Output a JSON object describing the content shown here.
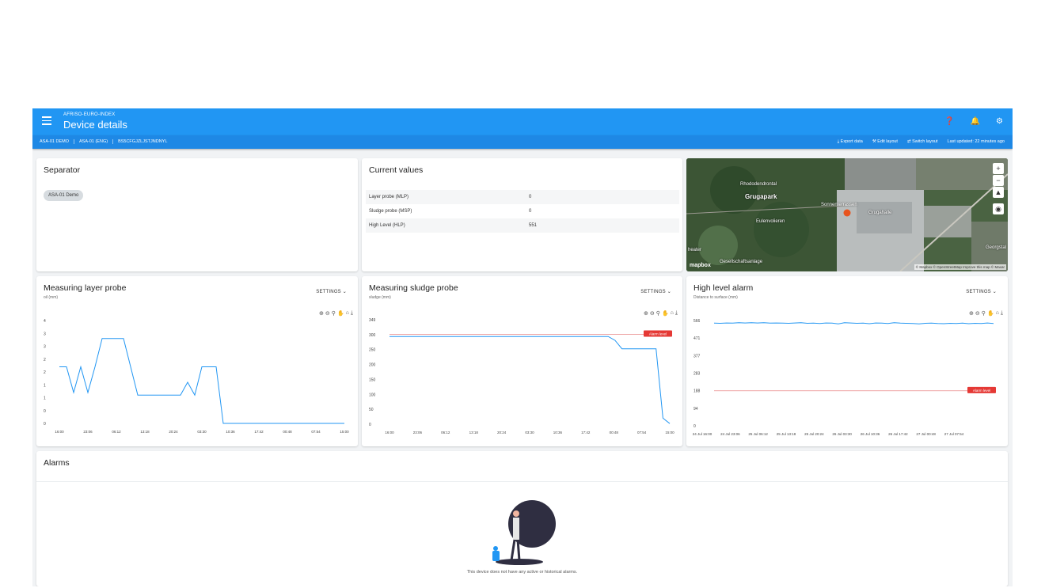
{
  "topbar": {
    "group": "AFRISO-EURO-INDEX",
    "title": "Device details",
    "icons": [
      "help-icon",
      "bell-icon",
      "user-settings-icon"
    ]
  },
  "subbar": {
    "crumbs": [
      "ASA-01 DEMO",
      "ASA-01 (ENG)",
      "BS5CFGJZLJSTJNDNYL"
    ],
    "export": "Export data",
    "edit_layout": "Edit layout",
    "switch_layout": "Switch layout",
    "last_updated": "Last updated: 22 minutes ago"
  },
  "separator": {
    "title": "Separator",
    "chip": "ASA-01 Demo"
  },
  "current_values": {
    "title": "Current values",
    "rows": [
      {
        "label": "Layer probe (MLP)",
        "value": "0"
      },
      {
        "label": "Sludge probe (MSP)",
        "value": "0"
      },
      {
        "label": "High Level (HLP)",
        "value": "551"
      }
    ]
  },
  "map": {
    "labels": [
      "Rhododendrontal",
      "Grugapark",
      "Eulenvolieren",
      "Sonnenterrassen",
      "Georgstal",
      "Grugahalle",
      "heater",
      "Gesellschaftsanlage"
    ],
    "attribution": "© Mapbox © OpenStreetMap Improve this map © Maxar",
    "logo": "mapbox",
    "marker_color": "#e8541e"
  },
  "settings_label": "SETTINGS",
  "chart_data": [
    {
      "type": "line",
      "title": "Measuring layer probe",
      "subtitle": "oil (mm)",
      "categories": [
        "16:00",
        "23:06",
        "06:12",
        "13:18",
        "20:24",
        "03:30",
        "10:36",
        "17:42",
        "00:48",
        "07:54",
        "15:00"
      ],
      "y_ticks": [
        "4",
        "3",
        "3",
        "2",
        "2",
        "1",
        "1",
        "0",
        "0"
      ],
      "ylim": [
        0,
        4
      ],
      "series": [
        {
          "values": [
            2.2,
            2.2,
            1.2,
            2.2,
            1.2,
            2.2,
            3.3,
            3.3,
            3.3,
            3.3,
            2.2,
            1.1,
            1.1,
            1.1,
            1.1,
            1.1,
            1.1,
            1.1,
            1.6,
            1.1,
            2.2,
            2.2,
            2.2,
            0,
            0,
            0,
            0,
            0,
            0,
            0,
            0,
            0,
            0,
            0,
            0,
            0,
            0,
            0,
            0,
            0,
            0
          ]
        }
      ],
      "color": "#2196f3"
    },
    {
      "type": "line",
      "title": "Measuring sludge probe",
      "subtitle": "sludge (mm)",
      "categories": [
        "16:00",
        "23:06",
        "06:12",
        "13:18",
        "20:24",
        "03:30",
        "10:36",
        "17:42",
        "00:48",
        "07:54",
        "15:00"
      ],
      "y_ticks": [
        "349",
        "300",
        "250",
        "200",
        "150",
        "100",
        "50",
        "0"
      ],
      "ylim": [
        0,
        349
      ],
      "alarm_level": 300,
      "alarm_label": "Alarm level",
      "series": [
        {
          "values": [
            293,
            293,
            293,
            293,
            293,
            293,
            293,
            293,
            293,
            293,
            293,
            293,
            293,
            293,
            293,
            293,
            293,
            293,
            293,
            293,
            293,
            293,
            293,
            293,
            293,
            293,
            293,
            293,
            293,
            293,
            293,
            293,
            293,
            280,
            252,
            252,
            252,
            252,
            252,
            252,
            20,
            2
          ]
        }
      ],
      "color": "#2196f3"
    },
    {
      "type": "line",
      "title": "High level alarm",
      "subtitle": "Distance to surface (mm)",
      "categories": [
        "24 Jul 16:00",
        "24 Jul 23:06",
        "25 Jul 06:12",
        "25 Jul 13:18",
        "25 Jul 20:24",
        "26 Jul 03:30",
        "26 Jul 10:36",
        "26 Jul 17:42",
        "27 Jul 00:48",
        "27 Jul 07:54"
      ],
      "y_ticks": [
        "566",
        "471",
        "377",
        "283",
        "188",
        "94",
        "0"
      ],
      "ylim": [
        0,
        566
      ],
      "alarm_level": 188,
      "alarm_label": "Alarm level",
      "series": [
        {
          "values": [
            552,
            551,
            553,
            552,
            554,
            553,
            554,
            553,
            554,
            552,
            553,
            552,
            551,
            553,
            554,
            551,
            552,
            550,
            553,
            552,
            548,
            554,
            553,
            551,
            552,
            549,
            553,
            552,
            550,
            554,
            552,
            551,
            550,
            548,
            551,
            552,
            550,
            549,
            551,
            550,
            552,
            549,
            551,
            550,
            553,
            550
          ]
        }
      ],
      "color": "#2196f3"
    }
  ],
  "alarms": {
    "title": "Alarms",
    "empty_text": "This device does not have any active or historical alarms."
  }
}
